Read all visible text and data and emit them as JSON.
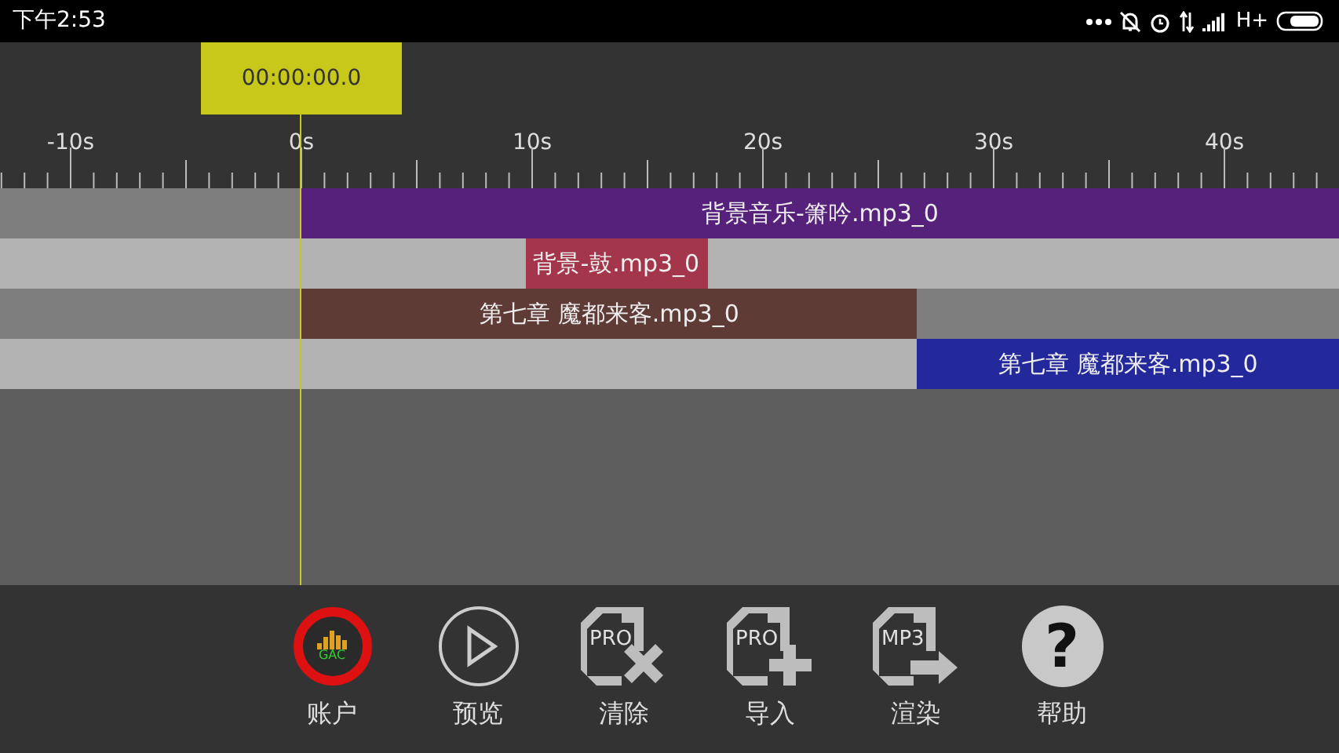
{
  "status_bar": {
    "time": "下午2:53",
    "network": "H+"
  },
  "timeline": {
    "position": "00:00:00.0",
    "ruler_labels": [
      "-10s",
      "0s",
      "10s",
      "20s",
      "30s",
      "40s"
    ],
    "tracks": [
      {
        "clip": "背景音乐-箫吟.mp3_0",
        "color": "#56217a"
      },
      {
        "clip": "背景-鼓.mp3_0",
        "color": "#a3364a"
      },
      {
        "clip": "第七章 魔都来客.mp3_0",
        "color": "#5e3b35"
      },
      {
        "clip": "第七章 魔都来客.mp3_0",
        "color": "#23299b"
      }
    ]
  },
  "toolbar": [
    {
      "kind": "account",
      "label": "账户",
      "badge": "GAC"
    },
    {
      "kind": "play",
      "label": "预览"
    },
    {
      "kind": "clear",
      "label": "清除",
      "badge": "PRO"
    },
    {
      "kind": "import",
      "label": "导入",
      "badge": "PRO"
    },
    {
      "kind": "render",
      "label": "渲染",
      "badge": "MP3"
    },
    {
      "kind": "help",
      "label": "帮助",
      "badge": "?"
    }
  ]
}
